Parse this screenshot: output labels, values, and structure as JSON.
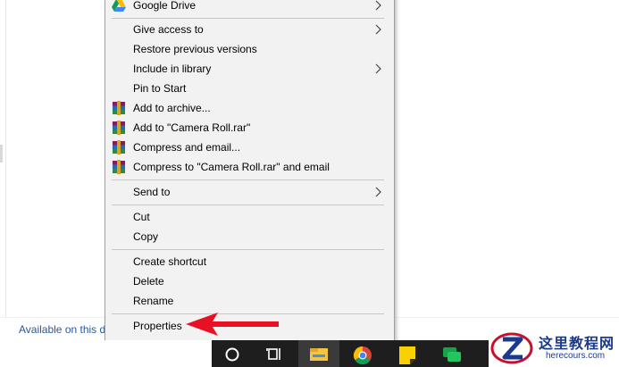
{
  "status": {
    "text": "Available on this d"
  },
  "context_menu": {
    "items": [
      {
        "label": "Google Drive",
        "icon": "google-drive-icon",
        "submenu": true
      },
      {
        "label": "Give access to",
        "submenu": true
      },
      {
        "label": "Restore previous versions",
        "submenu": false
      },
      {
        "label": "Include in library",
        "submenu": true
      },
      {
        "label": "Pin to Start",
        "submenu": false
      },
      {
        "label": "Add to archive...",
        "icon": "winrar-icon",
        "submenu": false
      },
      {
        "label": "Add to \"Camera Roll.rar\"",
        "icon": "winrar-icon",
        "submenu": false
      },
      {
        "label": "Compress and email...",
        "icon": "winrar-icon",
        "submenu": false
      },
      {
        "label": "Compress to \"Camera Roll.rar\" and email",
        "icon": "winrar-icon",
        "submenu": false
      },
      {
        "label": "Send to",
        "submenu": true
      },
      {
        "label": "Cut",
        "submenu": false
      },
      {
        "label": "Copy",
        "submenu": false
      },
      {
        "label": "Create shortcut",
        "submenu": false
      },
      {
        "label": "Delete",
        "submenu": false
      },
      {
        "label": "Rename",
        "submenu": false
      },
      {
        "label": "Properties",
        "submenu": false
      }
    ]
  },
  "taskbar": {
    "buttons": [
      {
        "name": "cortana-search-icon"
      },
      {
        "name": "task-view-icon"
      },
      {
        "name": "file-explorer-icon",
        "active": true
      },
      {
        "name": "chrome-icon"
      },
      {
        "name": "sticky-notes-icon"
      },
      {
        "name": "chat-icon"
      }
    ]
  },
  "watermark": {
    "title": "这里教程网",
    "url": "herecours.com"
  },
  "colors": {
    "menu_bg": "#f2f2f2",
    "arrow": "#e81123",
    "taskbar": "#1e1e1e",
    "watermark": "#1a3a8c"
  }
}
